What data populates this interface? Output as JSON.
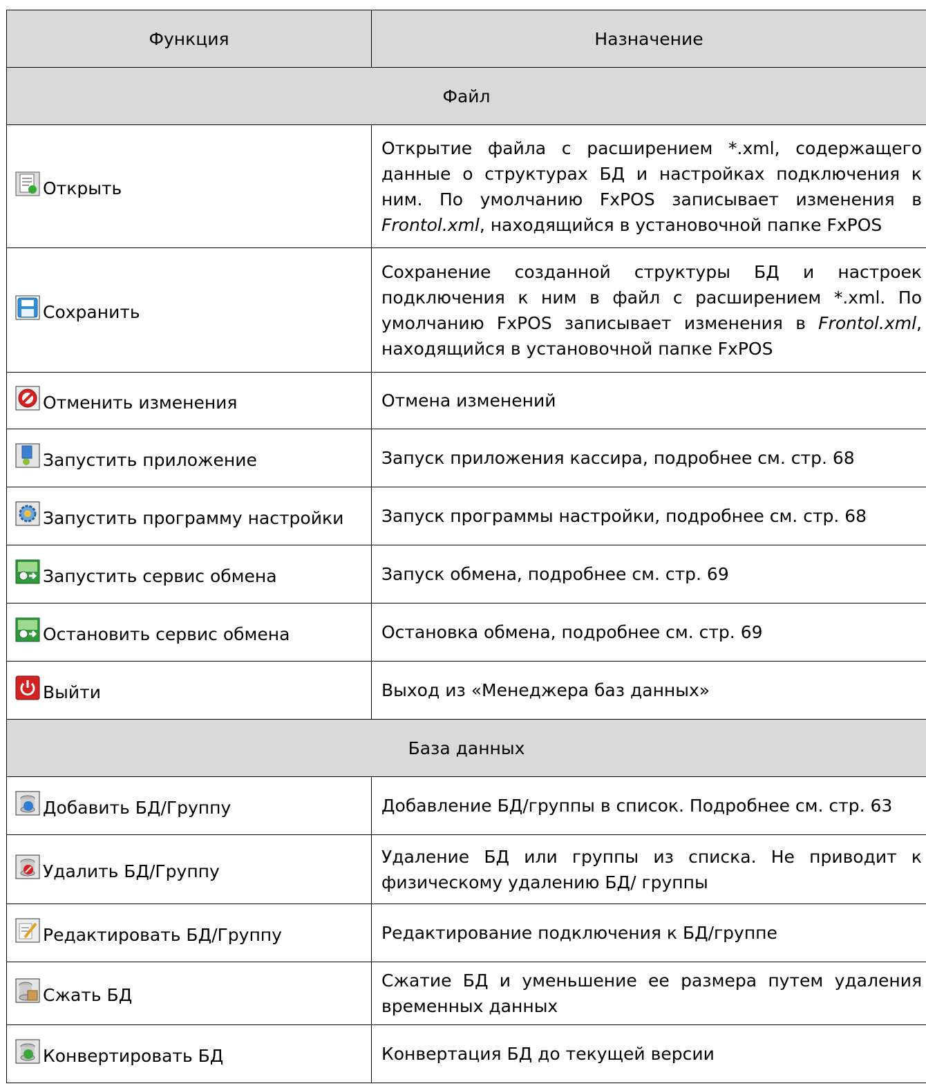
{
  "header": {
    "col_function": "Функция",
    "col_purpose": "Назначение"
  },
  "sections": [
    {
      "title": "Файл",
      "rows": [
        {
          "icon": "open-file-icon",
          "label": "Открыть",
          "desc_before": "Открытие файла с расширением *.xml, содержащего данные о структурах БД и настройках подключения к ним. По умолчанию FxPOS записывает изменения в ",
          "desc_italic": "Frontol.xml",
          "desc_after": ", находящийся в установочной папке FxPOS"
        },
        {
          "icon": "save-disk-icon",
          "label": "Сохранить",
          "desc_before": "Сохранение созданной структуры БД и настроек подключения к ним в файл с расширением *.xml. По умолчанию FxPOS записывает изменения в ",
          "desc_italic": "Frontol.xml",
          "desc_after": ", находящийся в установочной папке FxPOS"
        },
        {
          "icon": "cancel-icon",
          "label": "Отменить изменения",
          "desc": "Отмена изменений"
        },
        {
          "icon": "launch-app-icon",
          "label": "Запустить приложение",
          "desc": "Запуск приложения кассира, подробнее см. стр. 68"
        },
        {
          "icon": "settings-gear-icon",
          "label": "Запустить программу настройки",
          "desc": "Запуск программы настройки, подробнее см. стр. 68"
        },
        {
          "icon": "exchange-service-icon",
          "label": "Запустить сервис обмена",
          "desc": "Запуск обмена, подробнее см. стр. 69"
        },
        {
          "icon": "exchange-service-icon",
          "label": "Остановить сервис обмена",
          "desc": "Остановка обмена, подробнее см. стр. 69"
        },
        {
          "icon": "power-exit-icon",
          "label": "Выйти",
          "desc": "Выход из «Менеджера баз данных»"
        }
      ]
    },
    {
      "title": "База данных",
      "rows": [
        {
          "icon": "add-database-icon",
          "label": "Добавить БД/Группу",
          "desc": "Добавление БД/группы в список. Подробнее см. стр. 63"
        },
        {
          "icon": "delete-database-icon",
          "label": "Удалить БД/Группу",
          "desc": "Удаление БД или группы из списка. Не приводит к физическому удалению БД/ группы"
        },
        {
          "icon": "edit-database-icon",
          "label": "Редактировать БД/Группу",
          "desc": "Редактирование подключения к БД/группе"
        },
        {
          "icon": "compress-database-icon",
          "label": "Сжать БД",
          "desc": "Сжатие БД и уменьшение ее размера путем удаления временных данных"
        },
        {
          "icon": "convert-database-icon",
          "label": "Конвертировать БД",
          "desc": "Конвертация БД до текущей версии"
        }
      ]
    }
  ]
}
